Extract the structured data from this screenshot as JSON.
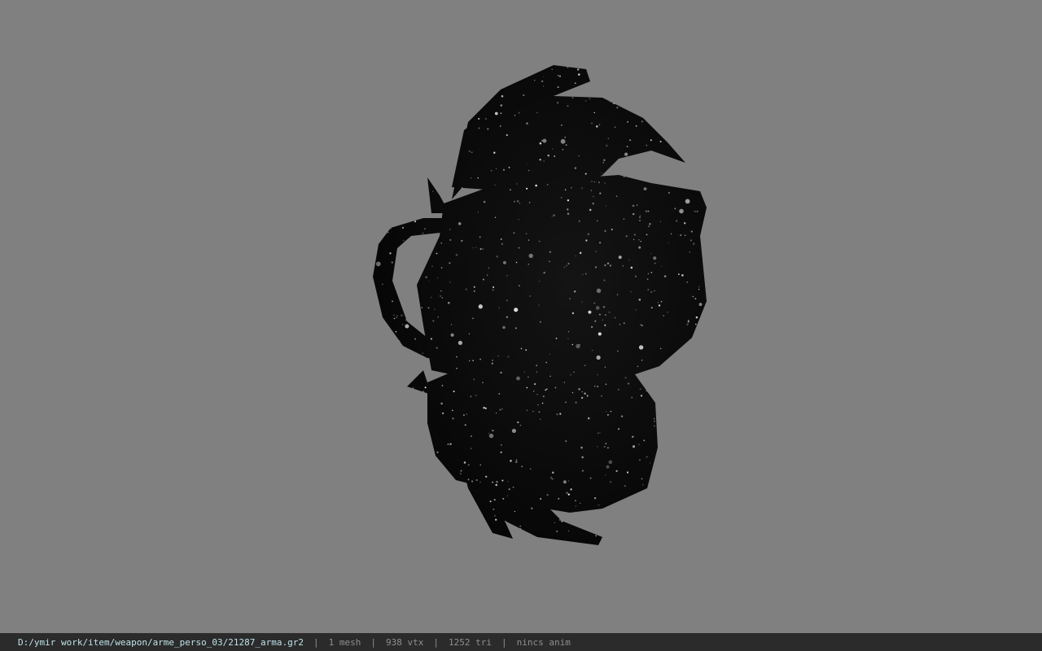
{
  "viewport": {
    "background": "#808080",
    "model_color": "#090909",
    "model_name": "sparkle-black-model"
  },
  "statusbar": {
    "path": "D:/ymir work/item/weapon/arme_perso_03/21287_arma.gr2",
    "separator": "|",
    "mesh": "1 mesh",
    "vertices": "938 vtx",
    "triangles": "1252 tri",
    "anim": "nincs anim"
  }
}
